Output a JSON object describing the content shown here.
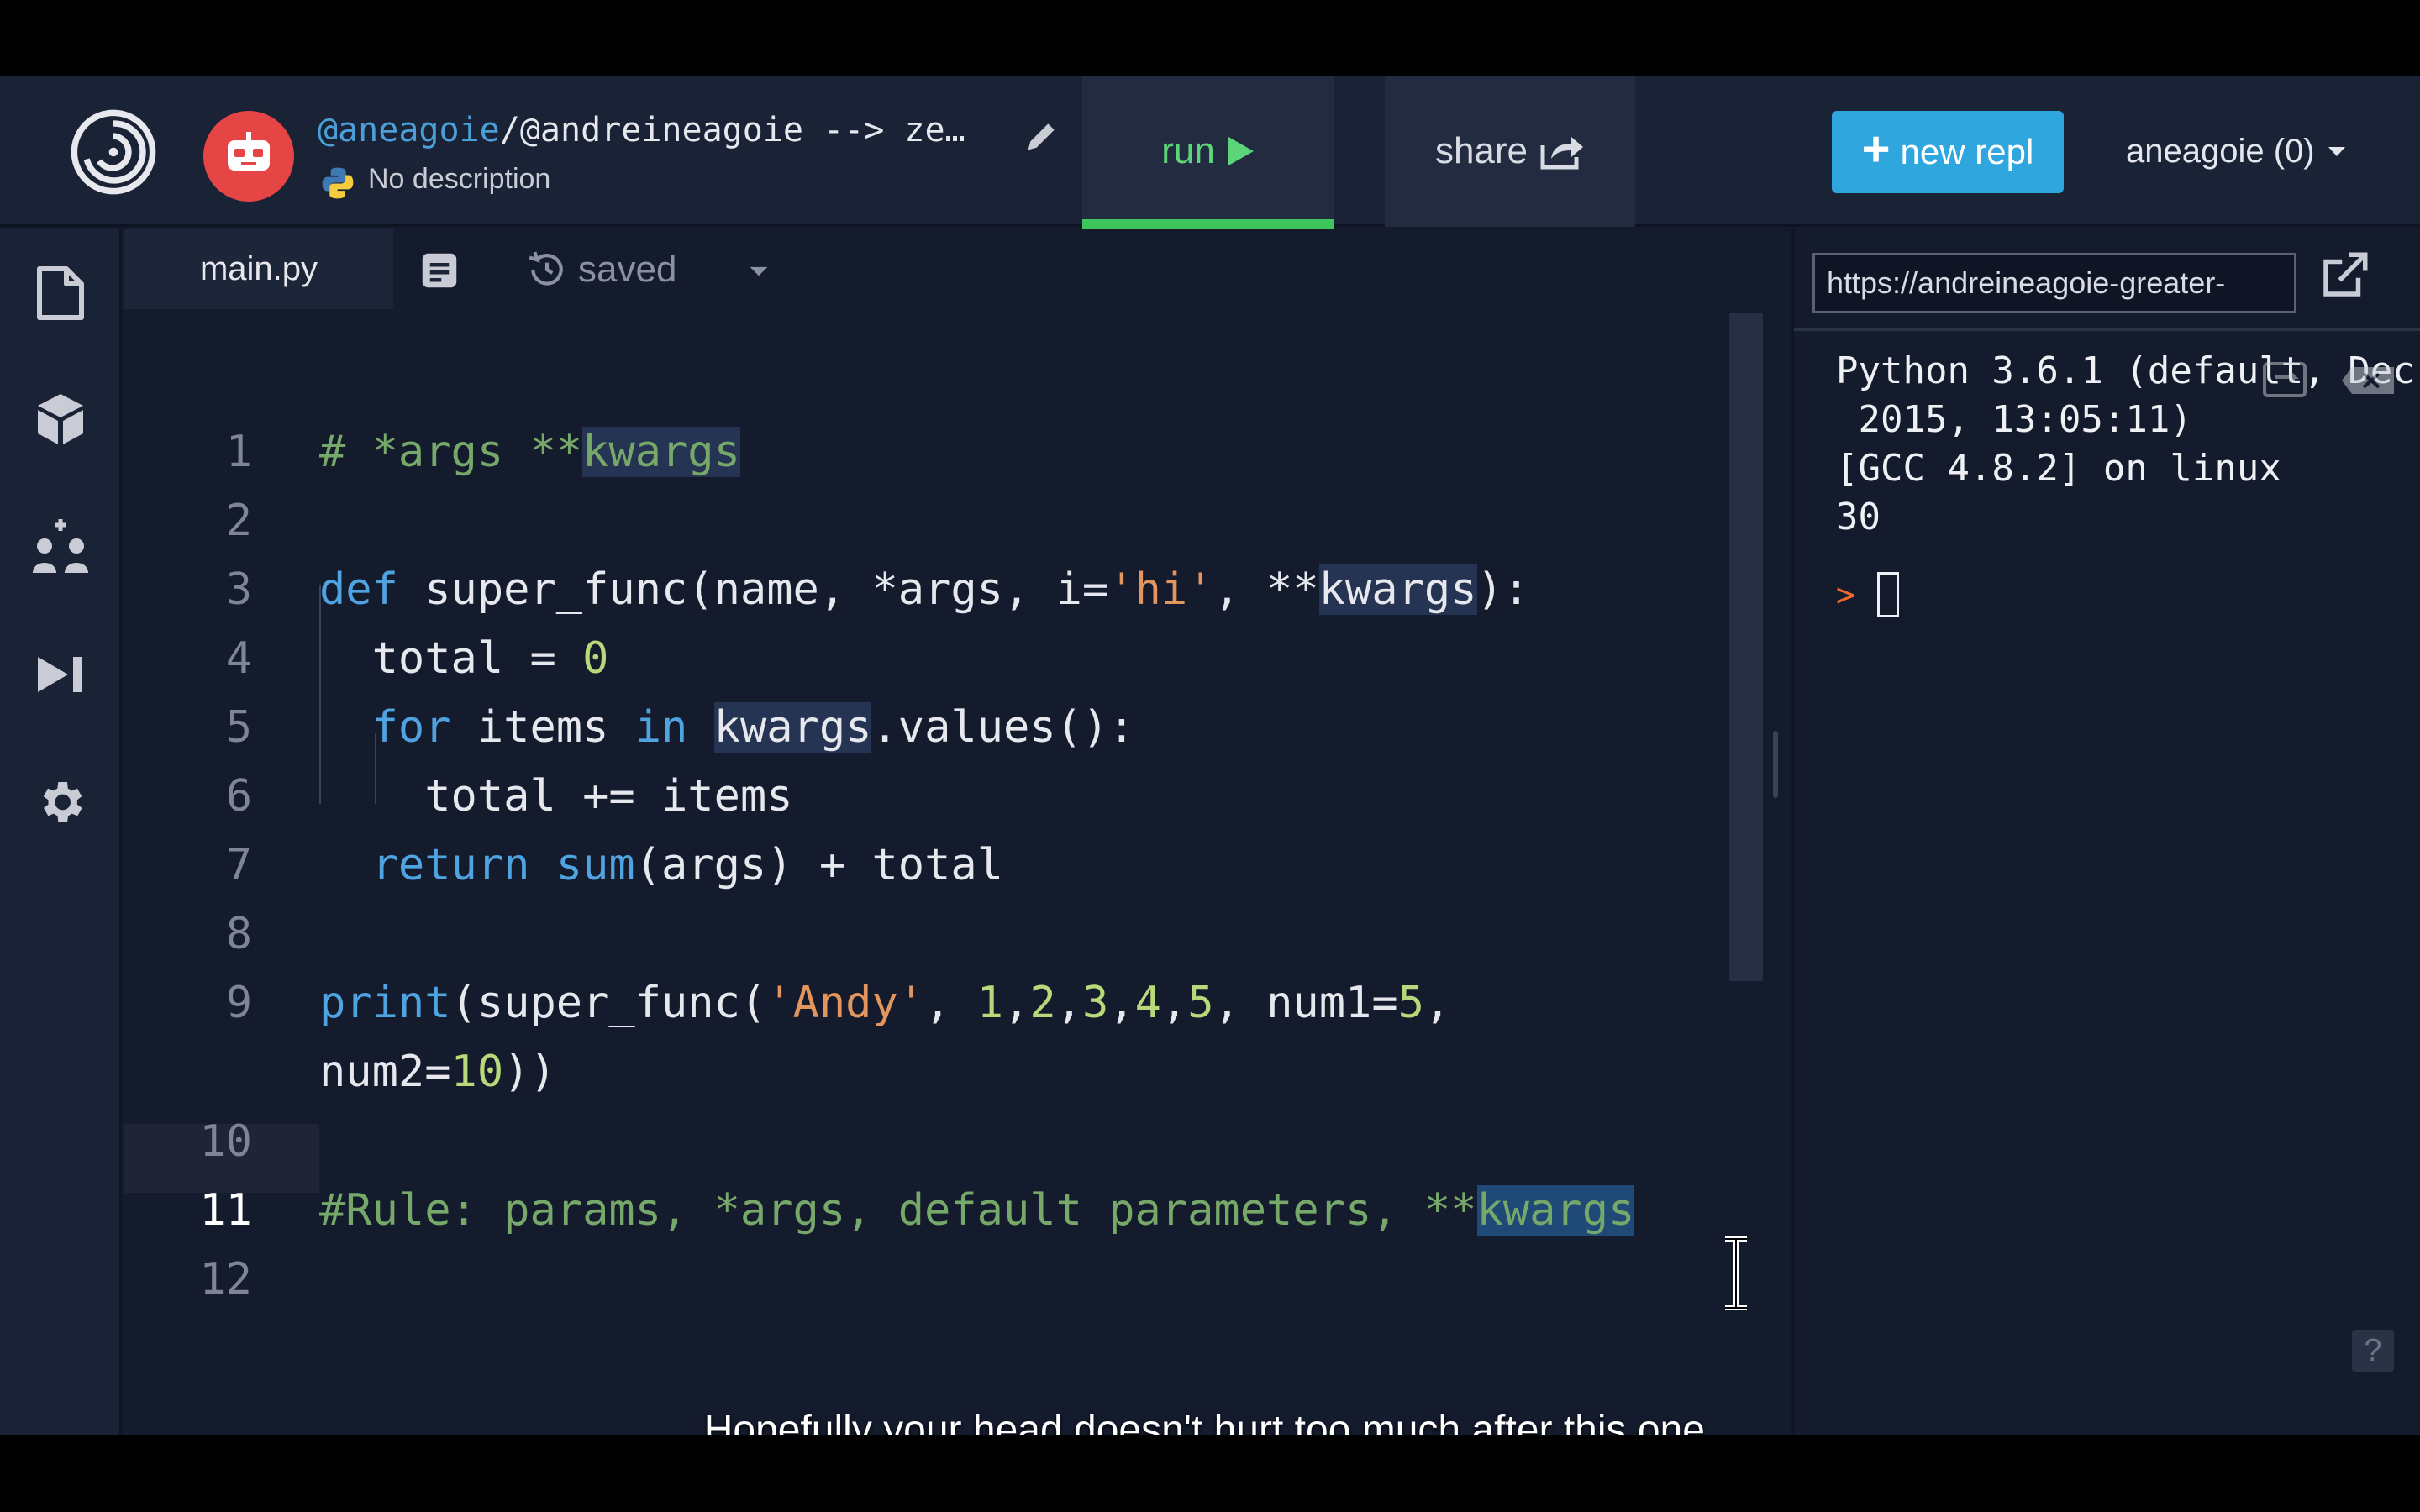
{
  "header": {
    "repl_user": "@aneagoie",
    "repl_title_rest": "/@andreineagoie --> ze…",
    "description": "No description",
    "run_label": "run",
    "share_label": "share",
    "new_repl_label": "new repl",
    "user_menu_label": "aneagoie (0)"
  },
  "editor": {
    "tab_label": "main.py",
    "saved_label": "saved",
    "line_numbers": [
      "1",
      "2",
      "3",
      "4",
      "5",
      "6",
      "7",
      "8",
      "9",
      "10",
      "11",
      "12"
    ]
  },
  "console": {
    "url": "https://andreineagoie-greater-",
    "output": "Python 3.6.1 (default, Dec\n 2015, 13:05:11)\n[GCC 4.8.2] on linux\n30",
    "prompt_symbol": ">",
    "help_label": "?"
  },
  "caption": "Hopefully your head doesn't hurt too much after this one.",
  "colors": {
    "accent_run": "#3ec55c",
    "new_repl_bg": "#2fa6dd",
    "keyword": "#4fa3e0",
    "string": "#e2955c",
    "number": "#b7d97a",
    "comment": "#76a86a"
  }
}
